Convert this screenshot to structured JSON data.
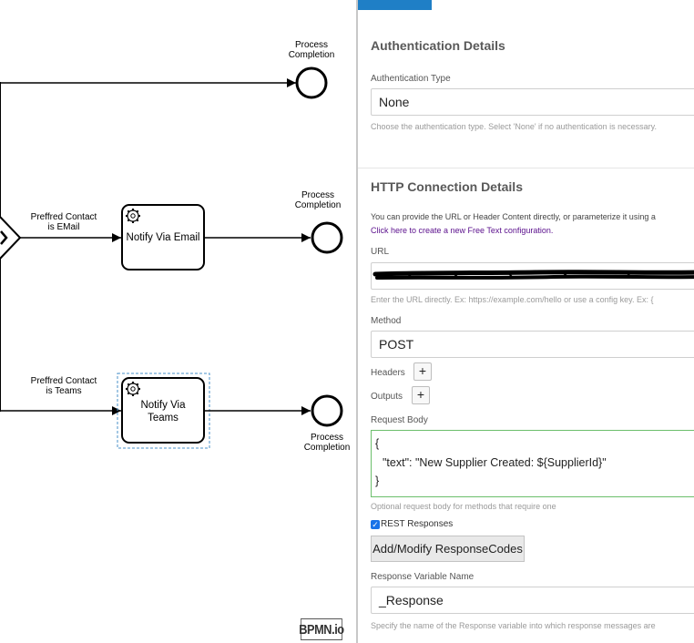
{
  "diagram": {
    "events": [
      {
        "label_line1": "Process",
        "label_line2": "Completion"
      },
      {
        "label_line1": "Process",
        "label_line2": "Completion"
      },
      {
        "label_line1": "Process",
        "label_line2": "Completion"
      }
    ],
    "flows": [
      {
        "label_line1": "Preffred Contact",
        "label_line2": "is EMail"
      },
      {
        "label_line1": "Preffred Contact",
        "label_line2": "is Teams"
      }
    ],
    "tasks": [
      {
        "line1": "Notify Via Email",
        "line2": ""
      },
      {
        "line1": "Notify Via",
        "line2": "Teams"
      }
    ],
    "watermark": "BPMN.io"
  },
  "panel": {
    "accent_color": "#1f7fc6",
    "auth": {
      "title": "Authentication Details",
      "type_label": "Authentication Type",
      "type_value": "None",
      "type_help": "Choose the authentication type. Select 'None' if no authentication is necessary."
    },
    "http": {
      "title": "HTTP Connection Details",
      "info": "You can provide the URL or Header Content directly, or parameterize it using a",
      "link": "Click here to create a new Free Text configuration.",
      "url_label": "URL",
      "url_help": "Enter the URL directly. Ex: https://example.com/hello or use a config key. Ex: {",
      "method_label": "Method",
      "method_value": "POST",
      "headers_label": "Headers",
      "outputs_label": "Outputs",
      "add_symbol": "+",
      "body_label": "Request Body",
      "body_lines": [
        "{",
        "\"text\": \"New Supplier Created: ${SupplierId}\"",
        "}"
      ],
      "body_help": "Optional request body for methods that require one",
      "rest_checked": true,
      "rest_label": "REST Responses",
      "response_codes_button": "Add/Modify ResponseCodes",
      "response_var_label": "Response Variable Name",
      "response_var_value": "_Response",
      "response_var_help": "Specify the name of the Response variable into which response messages are"
    }
  }
}
